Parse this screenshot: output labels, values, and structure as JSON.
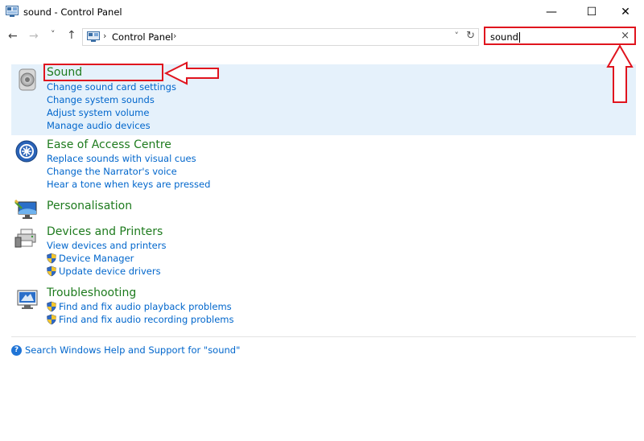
{
  "window": {
    "title": "sound - Control Panel",
    "minimize": "—",
    "maximize": "☐",
    "close": "✕"
  },
  "nav": {
    "back": "←",
    "forward": "→",
    "recent": "˅",
    "up": "↑",
    "breadcrumb_sep": "›",
    "breadcrumb": "Control Panel",
    "breadcrumb_sep2": "›",
    "address_dropdown": "˅",
    "refresh": "↻"
  },
  "search": {
    "value": "sound",
    "clear": "×"
  },
  "results": [
    {
      "title": "Sound",
      "icon": "speaker-icon",
      "links": [
        {
          "label": "Change sound card settings",
          "shield": false
        },
        {
          "label": "Change system sounds",
          "shield": false
        },
        {
          "label": "Adjust system volume",
          "shield": false
        },
        {
          "label": "Manage audio devices",
          "shield": false
        }
      ]
    },
    {
      "title": "Ease of Access Centre",
      "icon": "ease-of-access-icon",
      "links": [
        {
          "label": "Replace sounds with visual cues",
          "shield": false
        },
        {
          "label": "Change the Narrator's voice",
          "shield": false
        },
        {
          "label": "Hear a tone when keys are pressed",
          "shield": false
        }
      ]
    },
    {
      "title": "Personalisation",
      "icon": "personalisation-icon",
      "links": []
    },
    {
      "title": "Devices and Printers",
      "icon": "devices-printers-icon",
      "links": [
        {
          "label": "View devices and printers",
          "shield": false
        },
        {
          "label": "Device Manager",
          "shield": true
        },
        {
          "label": "Update device drivers",
          "shield": true
        }
      ]
    },
    {
      "title": "Troubleshooting",
      "icon": "troubleshooting-icon",
      "links": [
        {
          "label": "Find and fix audio playback problems",
          "shield": true
        },
        {
          "label": "Find and fix audio recording problems",
          "shield": true
        }
      ]
    }
  ],
  "help_link": "Search Windows Help and Support for \"sound\"",
  "colors": {
    "title_green": "#1e7b1e",
    "link_blue": "#0066cc",
    "selection": "#e5f1fb",
    "annotation_red": "#e0141e"
  }
}
